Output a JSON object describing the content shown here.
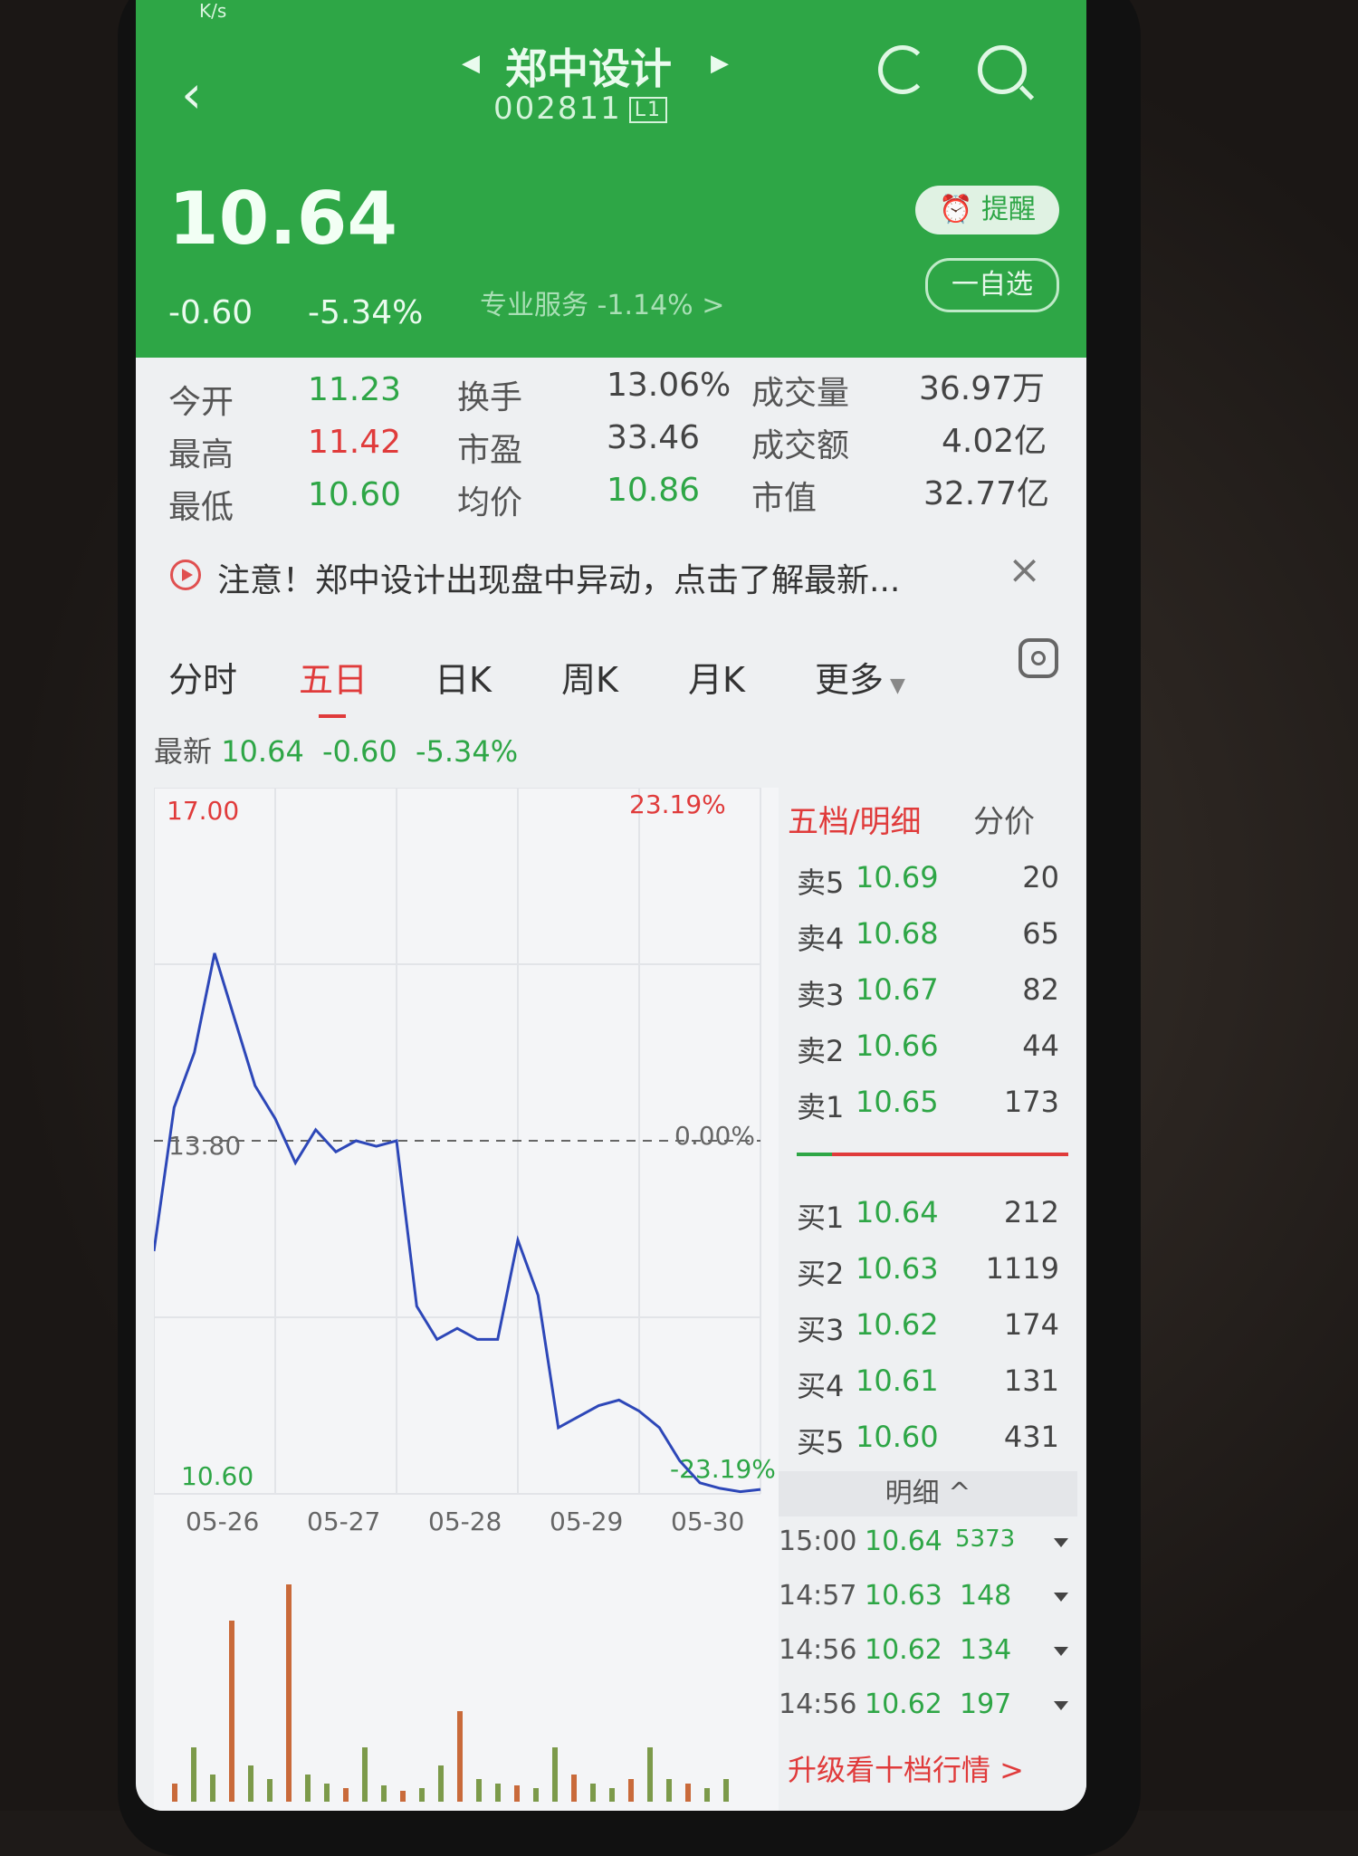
{
  "header": {
    "title": "郑中设计",
    "code": "002811",
    "level": "L1",
    "price": "10.64",
    "change": "-0.60",
    "change_pct": "-5.34%",
    "sector": "专业服务 -1.14% >",
    "alert_label": "提醒",
    "watchlist_label": "一自选",
    "status_text": "K/s"
  },
  "stats": [
    {
      "label": "今开",
      "value": "11.23",
      "color": "green"
    },
    {
      "label": "最高",
      "value": "11.42",
      "color": "red"
    },
    {
      "label": "最低",
      "value": "10.60",
      "color": "green"
    },
    {
      "label": "换手",
      "value": "13.06%"
    },
    {
      "label": "市盈",
      "value": "33.46"
    },
    {
      "label": "均价",
      "value": "10.86",
      "color": "green"
    },
    {
      "label": "成交量",
      "value": "36.97万"
    },
    {
      "label": "成交额",
      "value": "4.02亿"
    },
    {
      "label": "市值",
      "value": "32.77亿"
    }
  ],
  "notice": {
    "text": "注意！郑中设计出现盘中异动，点击了解最新...",
    "close": "×"
  },
  "tabs": [
    "分时",
    "五日",
    "日K",
    "周K",
    "月K",
    "更多"
  ],
  "active_tab": "五日",
  "latest": {
    "label": "最新",
    "price": "10.64",
    "change": "-0.60",
    "pct": "-5.34%"
  },
  "chart_data": {
    "type": "line",
    "x": [
      "05-26",
      "05-27",
      "05-28",
      "05-29",
      "05-30"
    ],
    "y_top_label": "17.00",
    "y_ref_label": "13.80",
    "y_bottom_label": "10.60",
    "top_pct": "23.19%",
    "ref_pct": "0.00%",
    "bottom_pct": "-23.19%",
    "ylim": [
      10.6,
      17.0
    ],
    "series": [
      {
        "values": [
          12.8,
          14.1,
          14.6,
          15.5,
          14.9,
          14.3,
          14.0,
          13.6,
          13.9,
          13.7,
          13.8,
          13.75,
          13.8,
          12.3,
          12.0,
          12.1,
          12.0,
          12.0,
          12.9,
          12.4,
          11.2,
          11.3,
          11.4,
          11.45,
          11.35,
          11.2,
          10.9,
          10.7,
          10.65,
          10.62,
          10.64
        ]
      }
    ]
  },
  "orderbook": {
    "tabs": [
      "五档/明细",
      "分价"
    ],
    "asks": [
      {
        "label": "卖5",
        "price": "10.69",
        "vol": "20"
      },
      {
        "label": "卖4",
        "price": "10.68",
        "vol": "65"
      },
      {
        "label": "卖3",
        "price": "10.67",
        "vol": "82"
      },
      {
        "label": "卖2",
        "price": "10.66",
        "vol": "44"
      },
      {
        "label": "卖1",
        "price": "10.65",
        "vol": "173"
      }
    ],
    "bids": [
      {
        "label": "买1",
        "price": "10.64",
        "vol": "212"
      },
      {
        "label": "买2",
        "price": "10.63",
        "vol": "1119"
      },
      {
        "label": "买3",
        "price": "10.62",
        "vol": "174"
      },
      {
        "label": "买4",
        "price": "10.61",
        "vol": "131"
      },
      {
        "label": "买5",
        "price": "10.60",
        "vol": "431"
      }
    ],
    "detail_label": "明细 ^",
    "ticks": [
      {
        "time": "15:00",
        "price": "10.64",
        "vol": "5373"
      },
      {
        "time": "14:57",
        "price": "10.63",
        "vol": "148"
      },
      {
        "time": "14:56",
        "price": "10.62",
        "vol": "134"
      },
      {
        "time": "14:56",
        "price": "10.62",
        "vol": "197"
      }
    ],
    "upgrade": "升级看十档行情 >"
  },
  "colors": {
    "header_green": "#2ea646",
    "up": "#e03b3b",
    "down": "#2ea646",
    "line": "#2d47b8"
  }
}
